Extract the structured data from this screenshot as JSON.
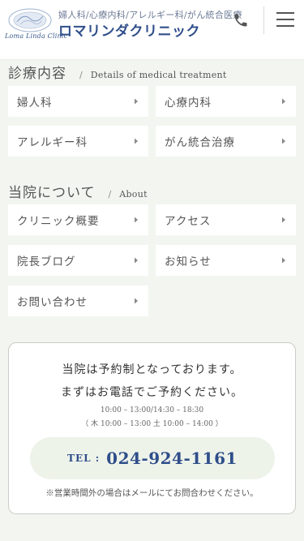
{
  "header": {
    "logo_script": "Loma Linda Clinic",
    "tagline": "婦人科/心療内科/アレルギー科/がん統合医療",
    "clinic_name": "ロマリンダクリニック",
    "phone_icon": "phone-icon",
    "menu_icon": "hamburger-menu-icon"
  },
  "treatment": {
    "heading_ja": "診療内容",
    "heading_sep": "/",
    "heading_en": "Details of medical treatment",
    "items": [
      {
        "label": "婦人科"
      },
      {
        "label": "心療内科"
      },
      {
        "label": "アレルギー科"
      },
      {
        "label": "がん統合治療"
      }
    ]
  },
  "about": {
    "heading_ja": "当院について",
    "heading_sep": "/",
    "heading_en": "About",
    "items": [
      {
        "label": "クリニック概要"
      },
      {
        "label": "アクセス"
      },
      {
        "label": "院長ブログ"
      },
      {
        "label": "お知らせ"
      },
      {
        "label": "お問い合わせ"
      }
    ]
  },
  "reservation": {
    "line1": "当院は予約制となっております。",
    "line2": "まずはお電話でご予約ください。",
    "hours1": "10:00 – 13:00/14:30 – 18:30",
    "hours2": "（ 木 10:00 – 13:00 土 10:00 – 14:00 ）",
    "tel_label": "TEL :",
    "tel_number": "024-924-1161",
    "note": "※営業時間外の場合はメールにてお問合わせください。"
  },
  "colors": {
    "background": "#f3f6f0",
    "brand_blue": "#2f4e8a",
    "tel_button_bg": "#eef3ea"
  }
}
